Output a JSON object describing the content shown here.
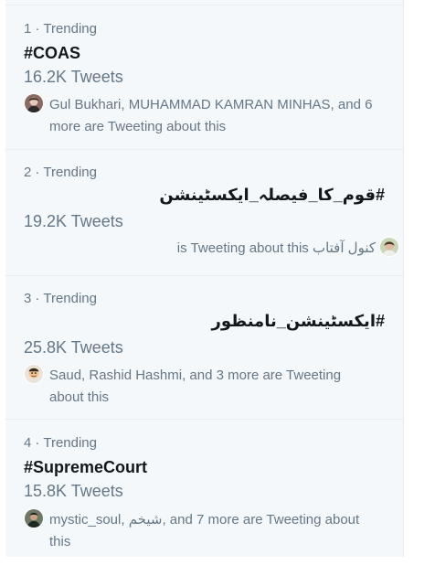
{
  "trends": [
    {
      "rank": "1",
      "label": "Trending",
      "hashtag": "#COAS",
      "tweets": "16.2K Tweets",
      "context": "Gul Bukhari, MUHAMMAD KAMRAN MINHAS, and 6 more are Tweeting about this",
      "avatar_icon": "user-avatar-icon"
    },
    {
      "rank": "2",
      "label": "Trending",
      "hashtag": "#قوم_کا_فیصلہ_ایکسٹینشن",
      "tweets": "19.2K Tweets",
      "context": "کنول آفتاب is Tweeting about this",
      "avatar_icon": "user-avatar-icon"
    },
    {
      "rank": "3",
      "label": "Trending",
      "hashtag": "#ایکسٹینشن_نامنظور",
      "tweets": "25.8K Tweets",
      "context": "Saud, Rashid Hashmi, and 3 more are Tweeting about this",
      "avatar_icon": "user-avatar-icon"
    },
    {
      "rank": "4",
      "label": "Trending",
      "hashtag": "#SupremeCourt",
      "tweets": "15.8K Tweets",
      "context": "mystic_soul, شیخم, and 7 more are Tweeting about this",
      "avatar_icon": "user-avatar-icon"
    }
  ],
  "separator": "·",
  "colors": {
    "panel_bg": "#f5f8fa",
    "divider": "#e6ecf0",
    "primary_text": "#14171a",
    "secondary_text": "#657786"
  }
}
